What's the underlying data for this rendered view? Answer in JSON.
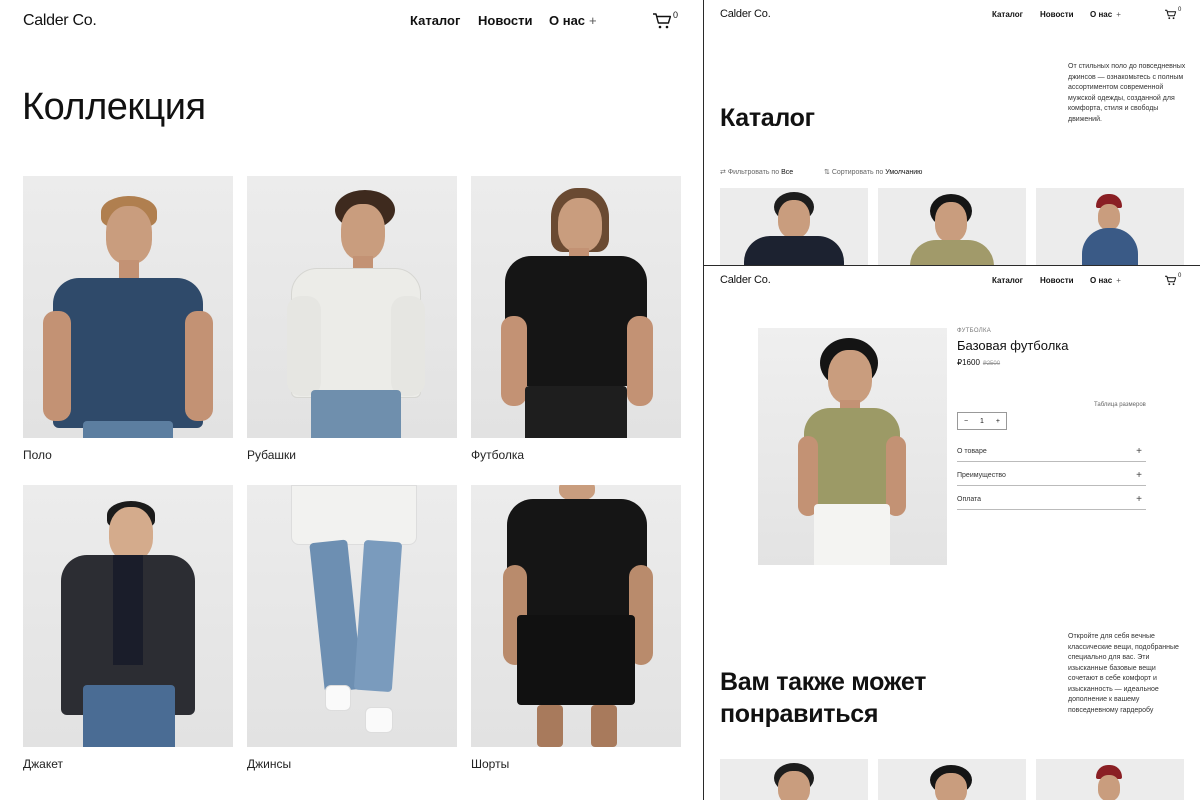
{
  "brand": "Calder Co.",
  "nav": {
    "catalog": "Каталог",
    "news": "Новости",
    "about": "О нас",
    "plus": "+",
    "cart_count": "0"
  },
  "collection": {
    "title": "Коллекция",
    "items": [
      {
        "label": "Поло"
      },
      {
        "label": "Рубашки"
      },
      {
        "label": "Футболка"
      },
      {
        "label": "Джакет"
      },
      {
        "label": "Джинсы"
      },
      {
        "label": "Шорты"
      }
    ]
  },
  "catalog": {
    "title": "Каталог",
    "description": "От стильных поло до повседневных джинсов — ознакомьтесь с полным ассортиментом современной мужской одежды, созданной для комфорта, стиля и свободы движений.",
    "filter_label": "Фильтровать по",
    "filter_value": "Все",
    "sort_label": "Сортировать по",
    "sort_value": "Умолчанию"
  },
  "product": {
    "category": "ФУТБОЛКА",
    "name": "Базовая футболка",
    "price": "₽1600",
    "old_price": "₽2500",
    "size_table": "Таблица размеров",
    "quantity": "1",
    "minus": "−",
    "plus": "+",
    "accordion": [
      "О товаре",
      "Преимущество",
      "Оплата"
    ]
  },
  "recommend": {
    "title_line1": "Вам также может",
    "title_line2": "понравиться",
    "description": "Откройте для себя вечные классические вещи, подобранные специально для вас. Эти изысканные базовые вещи сочетают в себе комфорт и изысканность — идеальное дополнение к вашему повседневному гардеробу"
  },
  "colors": {
    "accent": "#111111",
    "image_bg": "#ececec",
    "divider": "#2a2a2a"
  }
}
